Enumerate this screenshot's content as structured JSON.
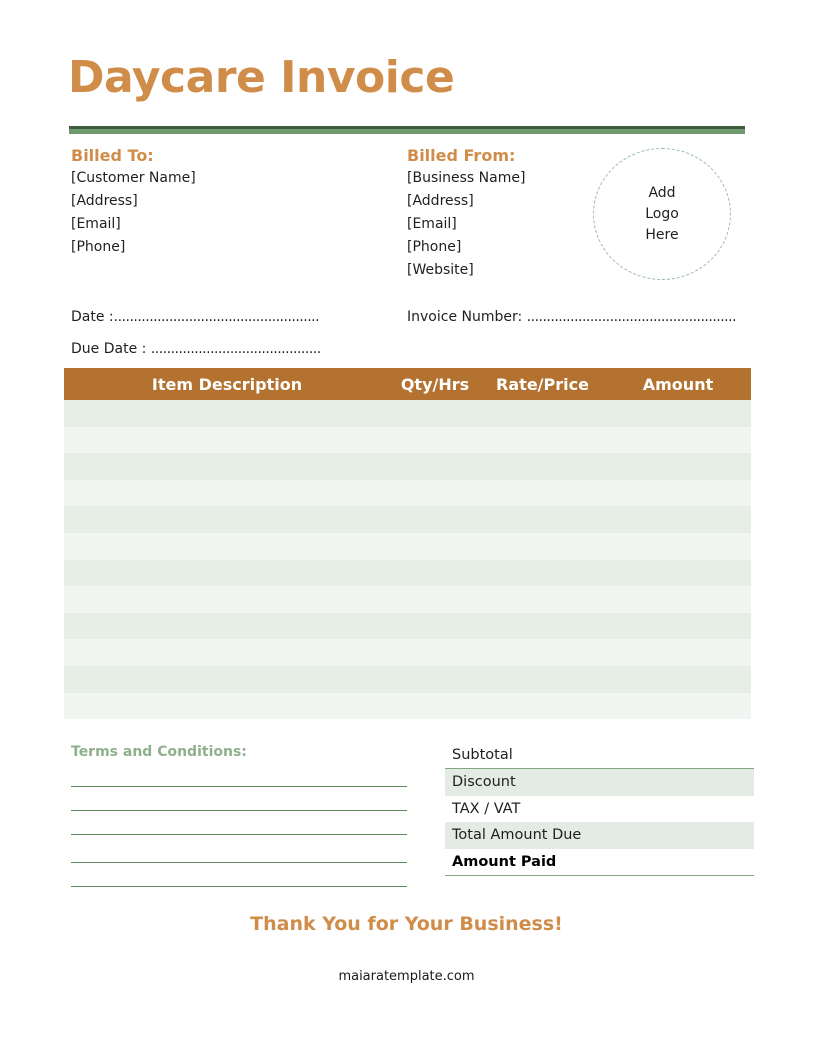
{
  "title": "Daycare Invoice",
  "colors": {
    "title": "#d08d49",
    "header_bar": "#b3722f",
    "rule_dark": "#3f5b3e",
    "rule_light": "#6f9a6d",
    "row_odd": "#e7eee6",
    "row_even": "#f1f6f2",
    "terms_heading": "#8fb08c"
  },
  "billed_to": {
    "heading": "Billed To:",
    "lines": [
      "[Customer Name]",
      "[Address]",
      "[Email]",
      "[Phone]"
    ]
  },
  "billed_from": {
    "heading": "Billed From:",
    "lines": [
      "[Business Name]",
      "[Address]",
      "[Email]",
      "[Phone]",
      "[Website]"
    ]
  },
  "logo": {
    "lines": [
      "Add",
      "Logo",
      "Here"
    ]
  },
  "fields": {
    "date_label": "Date :",
    "date_value": "....................................................",
    "due_date_label": "Due Date :",
    "due_date_value": "...........................................",
    "invoice_number_label": "Invoice Number:",
    "invoice_number_value": "....................................................."
  },
  "table": {
    "headers": [
      "Item Description",
      "Qty/Hrs",
      "Rate/Price",
      "Amount"
    ],
    "row_count": 12,
    "rows": []
  },
  "terms": {
    "heading": "Terms and Conditions:",
    "line_count": 5
  },
  "totals": {
    "subtotal": "Subtotal",
    "discount": "Discount",
    "tax": "TAX / VAT",
    "total_due": "Total Amount Due",
    "amount_paid": "Amount Paid"
  },
  "footer": {
    "thanks": "Thank You for Your Business!",
    "website": "maiaratemplate.com"
  }
}
